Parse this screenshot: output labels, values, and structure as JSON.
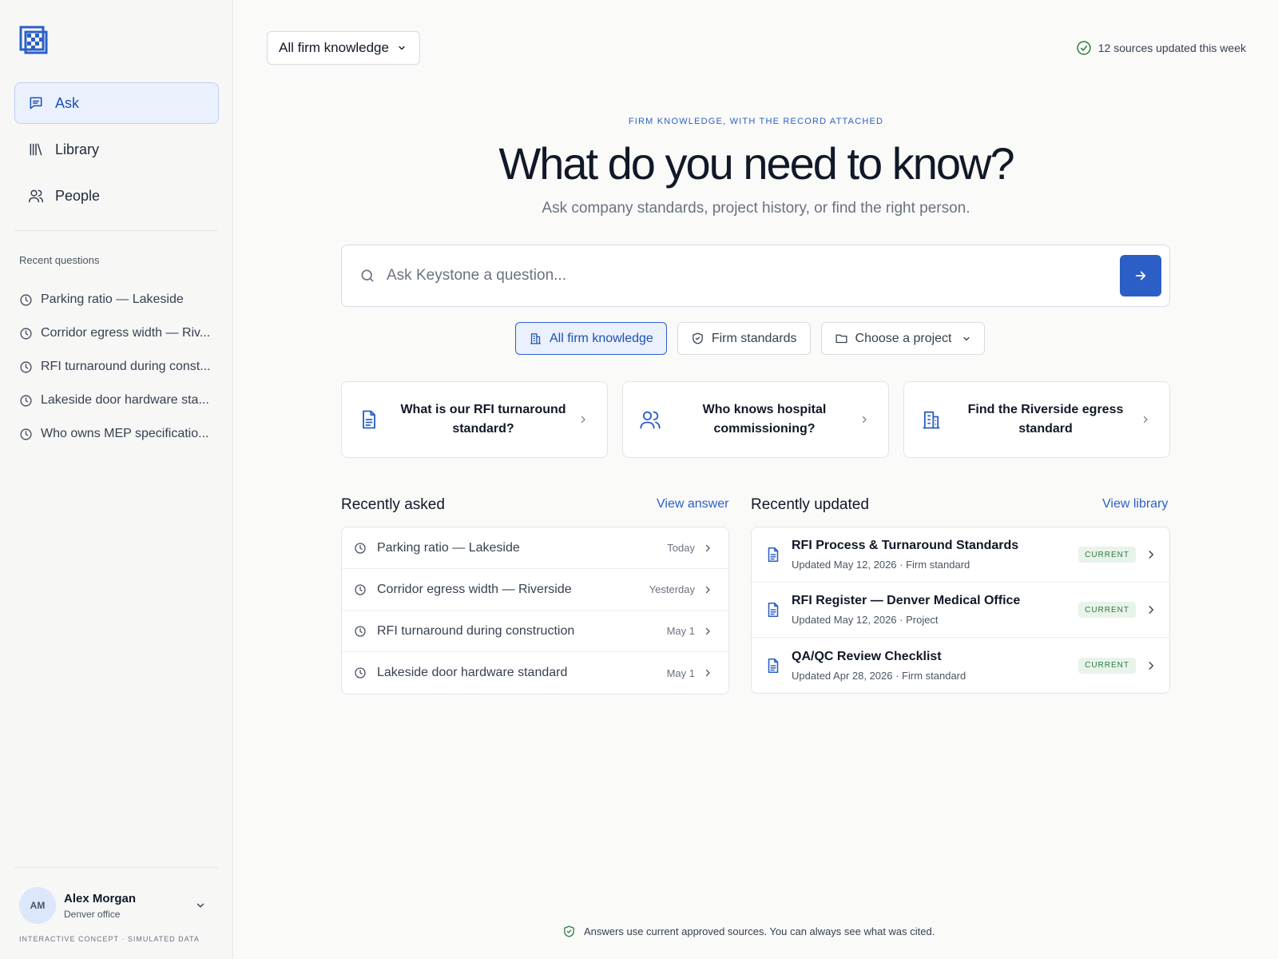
{
  "sidebar": {
    "nav": [
      {
        "label": "Ask",
        "icon": "chat-icon",
        "active": true
      },
      {
        "label": "Library",
        "icon": "library-icon",
        "active": false
      },
      {
        "label": "People",
        "icon": "people-icon",
        "active": false
      }
    ],
    "recent_title": "Recent questions",
    "recent": [
      "Parking ratio — Lakeside",
      "Corridor egress width — Riv...",
      "RFI turnaround during const...",
      "Lakeside door hardware sta...",
      "Who owns MEP specificatio..."
    ],
    "user": {
      "initials": "AM",
      "name": "Alex Morgan",
      "office": "Denver office"
    },
    "concept_note": "INTERACTIVE CONCEPT · SIMULATED DATA"
  },
  "header": {
    "scope_label": "All firm knowledge",
    "sources_status": "12 sources updated this week"
  },
  "hero": {
    "eyebrow": "FIRM KNOWLEDGE, WITH THE RECORD ATTACHED",
    "title": "What do you need to know?",
    "subtitle": "Ask company standards, project history, or find the right person."
  },
  "search": {
    "placeholder": "Ask Keystone a question...",
    "value": ""
  },
  "chips": [
    {
      "label": "All firm knowledge",
      "icon": "building-icon",
      "active": true
    },
    {
      "label": "Firm standards",
      "icon": "shield-check-icon",
      "active": false
    },
    {
      "label": "Choose a project",
      "icon": "folder-icon",
      "active": false
    }
  ],
  "suggestions": [
    {
      "label": "What is our RFI turnaround standard?",
      "icon": "document-icon"
    },
    {
      "label": "Who knows hospital commissioning?",
      "icon": "people-icon"
    },
    {
      "label": "Find the Riverside egress standard",
      "icon": "building-icon"
    }
  ],
  "recently_asked": {
    "title": "Recently asked",
    "link": "View answer",
    "items": [
      {
        "question": "Parking ratio — Lakeside",
        "when": "Today"
      },
      {
        "question": "Corridor egress width — Riverside",
        "when": "Yesterday"
      },
      {
        "question": "RFI turnaround during construction",
        "when": "May 1"
      },
      {
        "question": "Lakeside door hardware standard",
        "when": "May 1"
      }
    ]
  },
  "recently_updated": {
    "title": "Recently updated",
    "link": "View library",
    "items": [
      {
        "title": "RFI Process & Turnaround Standards",
        "meta": "Updated May 12, 2026 · Firm standard",
        "status": "CURRENT"
      },
      {
        "title": "RFI Register — Denver Medical Office",
        "meta": "Updated May 12, 2026 · Project",
        "status": "CURRENT"
      },
      {
        "title": "QA/QC Review Checklist",
        "meta": "Updated Apr 28, 2026 · Firm standard",
        "status": "CURRENT"
      }
    ]
  },
  "footnote": "Answers use current approved sources. You can always see what was cited.",
  "colors": {
    "accent": "#2b5fc6",
    "accent_bg": "#eaf1fd",
    "current_badge_bg": "#e8f3ea",
    "current_badge_fg": "#2f7a3e",
    "status_ok": "#2f7a3e"
  }
}
